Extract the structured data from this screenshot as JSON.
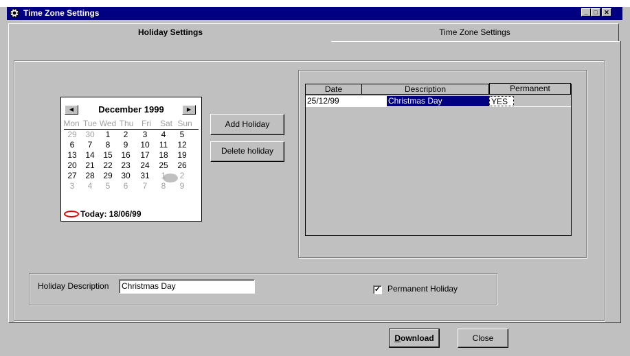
{
  "window": {
    "title": "Time Zone Settings"
  },
  "tabs": [
    {
      "label": "Holiday Settings",
      "active": true
    },
    {
      "label": "Time Zone Settings",
      "active": false
    }
  ],
  "calendar": {
    "month_label": "December 1999",
    "prev_icon": "arrow-left-icon",
    "next_icon": "arrow-right-icon",
    "dow": [
      "Mon",
      "Tue",
      "Wed",
      "Thu",
      "Fri",
      "Sat",
      "Sun"
    ],
    "weeks": [
      [
        "29",
        "30",
        "1",
        "2",
        "3",
        "4",
        "5"
      ],
      [
        "6",
        "7",
        "8",
        "9",
        "10",
        "11",
        "12"
      ],
      [
        "13",
        "14",
        "15",
        "16",
        "17",
        "18",
        "19"
      ],
      [
        "20",
        "21",
        "22",
        "23",
        "24",
        "25",
        "26"
      ],
      [
        "27",
        "28",
        "29",
        "30",
        "31",
        "1",
        "2"
      ],
      [
        "3",
        "4",
        "5",
        "6",
        "7",
        "8",
        "9"
      ]
    ],
    "selected_day": "25",
    "today_label": "Today: 18/06/99"
  },
  "buttons": {
    "add_holiday": "Add Holiday",
    "delete_holiday": "Delete holiday",
    "download": "Download",
    "close": "Close"
  },
  "grid": {
    "columns": [
      "Date",
      "Description",
      "Permanent"
    ],
    "rows": [
      {
        "date": "25/12/99",
        "description": "Christmas Day",
        "permanent": "YES"
      }
    ]
  },
  "form": {
    "description_label": "Holiday Description",
    "description_value": "Christmas Day",
    "permanent_label": "Permanent Holiday",
    "permanent_checked": true
  },
  "colors": {
    "titlebar": "#000080",
    "selection": "#000080",
    "face": "#c0c0c0",
    "today_marker": "#e00000"
  }
}
